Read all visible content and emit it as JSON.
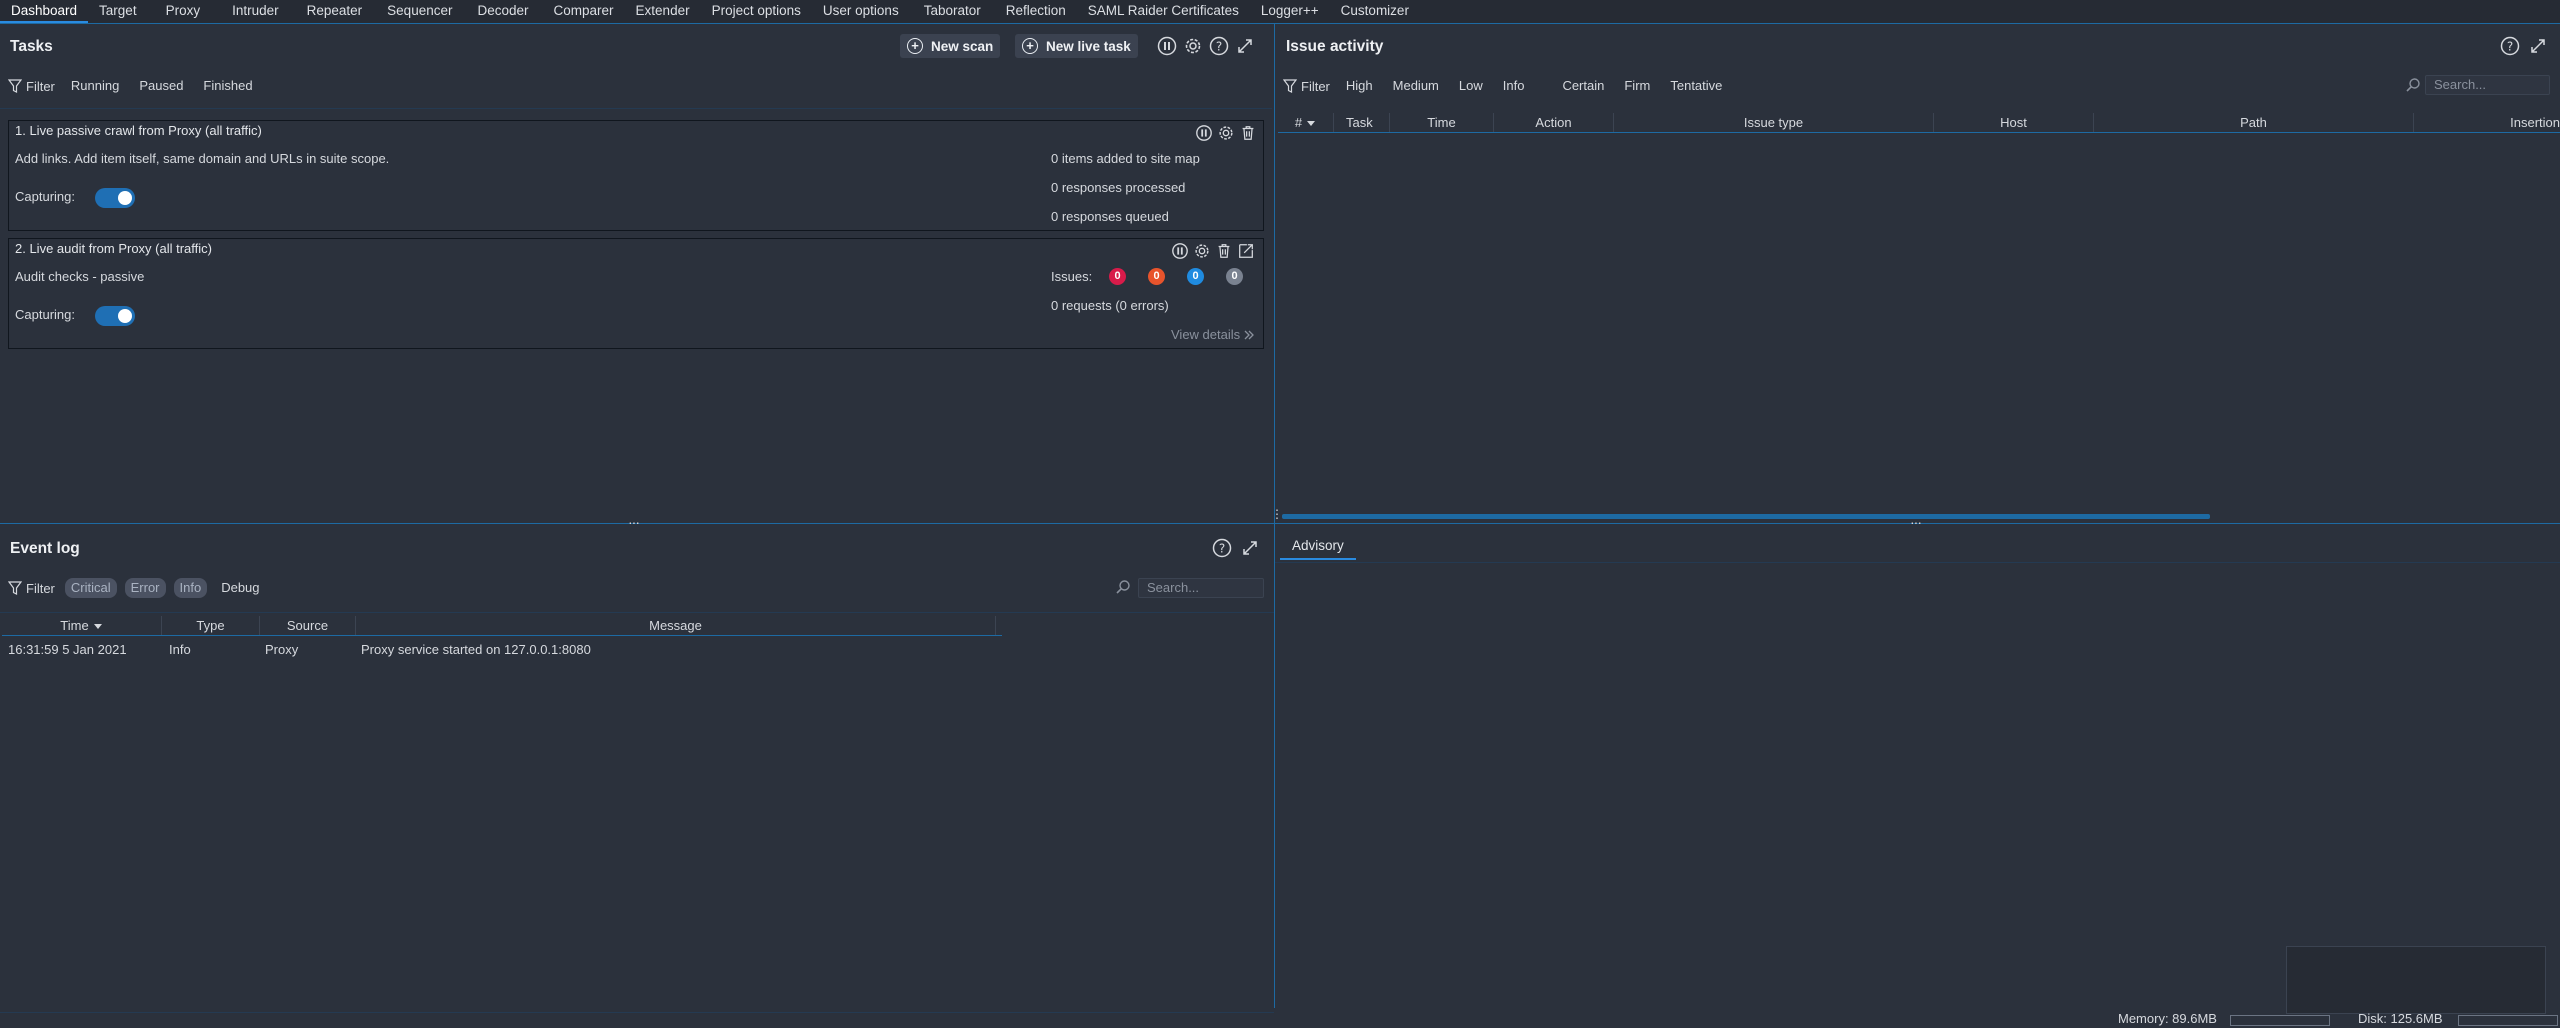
{
  "tabs": [
    {
      "label": "Dashboard"
    },
    {
      "label": "Target"
    },
    {
      "label": "Proxy"
    },
    {
      "label": "Intruder"
    },
    {
      "label": "Repeater"
    },
    {
      "label": "Sequencer"
    },
    {
      "label": "Decoder"
    },
    {
      "label": "Comparer"
    },
    {
      "label": "Extender"
    },
    {
      "label": "Project options"
    },
    {
      "label": "User options"
    },
    {
      "label": "Taborator"
    },
    {
      "label": "Reflection"
    },
    {
      "label": "SAML Raider Certificates"
    },
    {
      "label": "Logger++"
    },
    {
      "label": "Customizer"
    }
  ],
  "tasks": {
    "title": "Tasks",
    "new_scan_label": "New scan",
    "new_live_task_label": "New live task",
    "filter_label": "Filter",
    "filters": [
      "Running",
      "Paused",
      "Finished"
    ],
    "items": [
      {
        "title": "1. Live passive crawl from Proxy (all traffic)",
        "description": "Add links. Add item itself, same domain and URLs in suite scope.",
        "capturing_label": "Capturing:",
        "stats": [
          "0 items added to site map",
          "0 responses processed",
          "0 responses queued"
        ]
      },
      {
        "title": "2. Live audit from Proxy (all traffic)",
        "description": "Audit checks - passive",
        "capturing_label": "Capturing:",
        "issues_label": "Issues:",
        "issue_counts": [
          "0",
          "0",
          "0",
          "0"
        ],
        "issue_colors": [
          "#d81b4a",
          "#e8542c",
          "#1f8be0",
          "#7a8290"
        ],
        "requests": "0 requests (0 errors)",
        "view_details": "View details"
      }
    ]
  },
  "issue_activity": {
    "title": "Issue activity",
    "filter_label": "Filter",
    "severity_filters": [
      "High",
      "Medium",
      "Low",
      "Info"
    ],
    "confidence_filters": [
      "Certain",
      "Firm",
      "Tentative"
    ],
    "search_placeholder": "Search...",
    "columns": [
      "#",
      "Task",
      "Time",
      "Action",
      "Issue type",
      "Host",
      "Path",
      "Insertion"
    ]
  },
  "event_log": {
    "title": "Event log",
    "filter_label": "Filter",
    "filters": [
      "Critical",
      "Error",
      "Info",
      "Debug"
    ],
    "search_placeholder": "Search...",
    "columns": [
      "Time",
      "Type",
      "Source",
      "Message"
    ],
    "rows": [
      {
        "time": "16:31:59 5 Jan 2021",
        "type": "Info",
        "source": "Proxy",
        "message": "Proxy service started on 127.0.0.1:8080"
      }
    ]
  },
  "advisory": {
    "tab_label": "Advisory"
  },
  "status": {
    "memory": "Memory: 89.6MB",
    "disk": "Disk: 125.6MB"
  },
  "colors": {
    "accent": "#1d6aa3",
    "background": "#2b313c",
    "toggle": "#1f6fb4"
  }
}
